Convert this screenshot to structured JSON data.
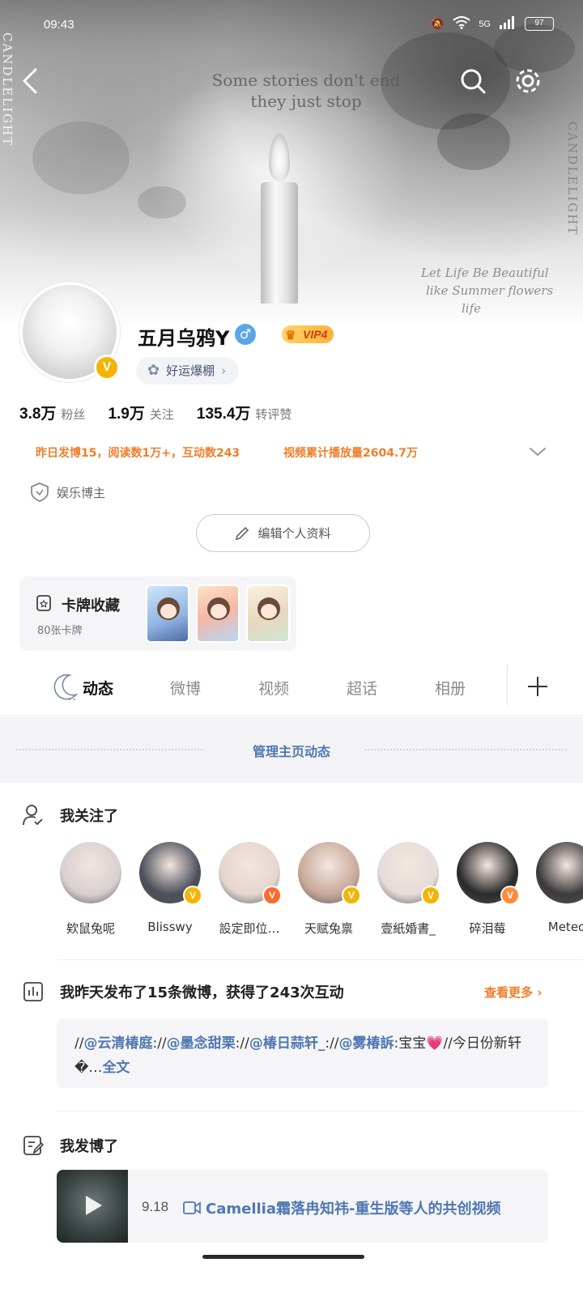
{
  "status_bar": {
    "time": "09:43",
    "network": "5G",
    "battery": "97"
  },
  "banner": {
    "quote_line1": "Some stories don't end",
    "quote_line2": "they just stop",
    "left_vertical": "CANDLELIGHT",
    "right_vertical": "CANDLELIGHT",
    "script_line1": "Let Life Be Beautiful",
    "script_line2": "like Summer flowers",
    "script_line3": "life"
  },
  "profile": {
    "username": "五月乌鸦Y",
    "gender_symbol": "♂",
    "verified_badge": "V",
    "vip_label": "VIP4",
    "luck_chip_label": "好运爆棚"
  },
  "stats": [
    {
      "num": "3.8万",
      "label": "粉丝"
    },
    {
      "num": "1.9万",
      "label": "关注"
    },
    {
      "num": "135.4万",
      "label": "转评赞"
    }
  ],
  "activity": {
    "yesterday": "昨日发博15，阅读数1万+，互动数243",
    "video_plays": "视频累计播放量2604.7万"
  },
  "role": {
    "label": "娱乐博主"
  },
  "edit_profile_label": "编辑个人资料",
  "cards": {
    "title": "卡牌收藏",
    "count": "80张卡牌"
  },
  "tabs": [
    "动态",
    "微博",
    "视频",
    "超话",
    "相册"
  ],
  "manage_label": "管理主页动态",
  "following": {
    "title": "我关注了",
    "users": [
      {
        "name": "欸鼠兔呢",
        "badge": "",
        "color": "#d8cfd0"
      },
      {
        "name": "Blisswy",
        "badge": "V",
        "badge_color": "#f4b400",
        "color": "#4a4f5a"
      },
      {
        "name": "設定即位…",
        "badge": "V",
        "badge_color": "#ff6a2a",
        "color": "#e4d6cf"
      },
      {
        "name": "天赋兔禀",
        "badge": "V",
        "badge_color": "#f4b400",
        "color": "#c8a99a"
      },
      {
        "name": "壹紙婚書_",
        "badge": "V",
        "badge_color": "#f4b400",
        "color": "#e6dcda"
      },
      {
        "name": "碎泪莓",
        "badge": "V",
        "badge_color": "#ff8a3a",
        "color": "#2a2a2a"
      },
      {
        "name": "Meteo",
        "badge": "",
        "color": "#3b3b3b"
      }
    ]
  },
  "summary": {
    "title": "我昨天发布了15条微博，获得了243次互动",
    "see_more": "查看更多",
    "post_prefix": "//",
    "mention1": "@云清椿庭",
    "sep1": "://",
    "mention2": "@墨念甜栗",
    "sep2": "://",
    "mention3": "@椿日蒜轩_",
    "sep3": "://",
    "mention4": "@雾椿訴",
    "text_a": ":宝宝",
    "heart": "💗",
    "text_b": "//今日份新轩�…",
    "full_text": "全文"
  },
  "posted": {
    "title": "我发博了",
    "video_date": "9.18",
    "video_title": "Camellia霜落冉知祎-重生版等人的共创视频"
  }
}
